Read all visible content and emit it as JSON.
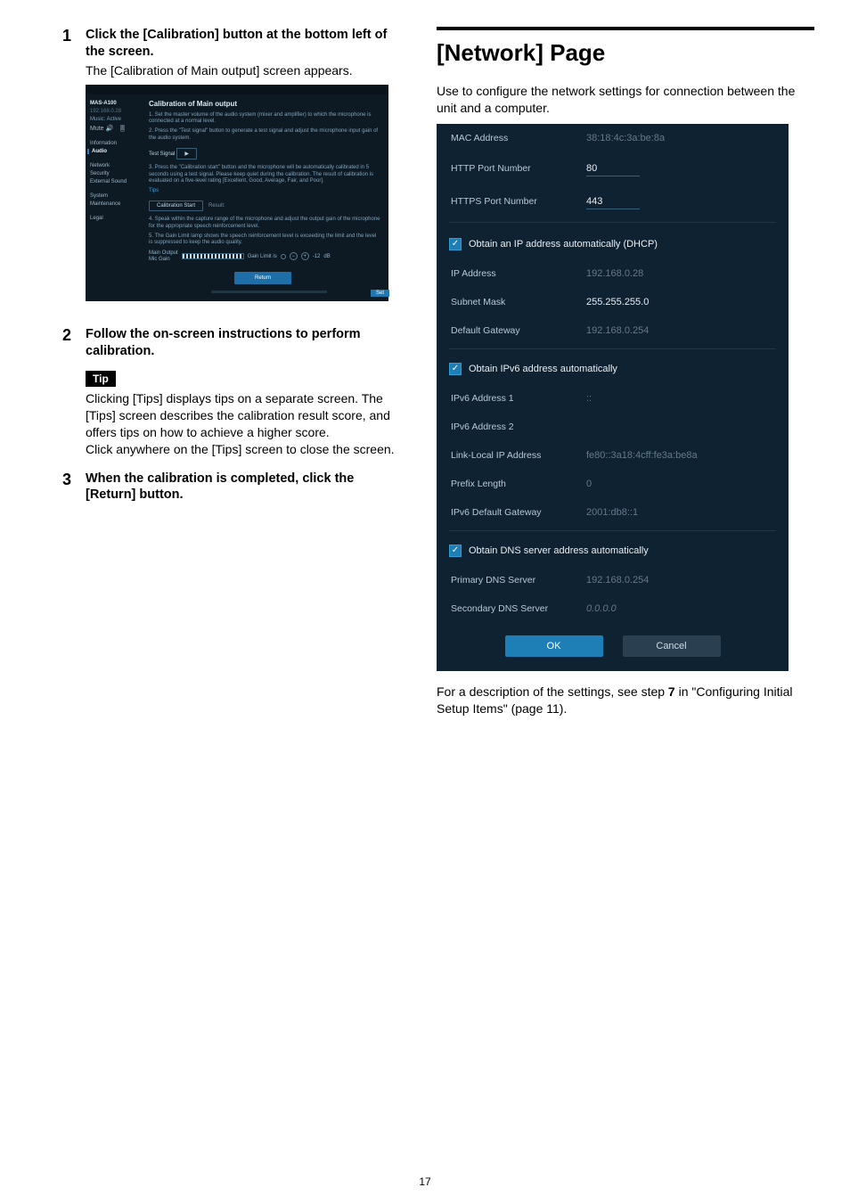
{
  "page_number": "17",
  "left": {
    "steps": [
      {
        "num": "1",
        "title": "Click the [Calibration] button at the bottom left of the screen.",
        "sub": "The [Calibration of Main output] screen appears."
      },
      {
        "num": "2",
        "title": "Follow the on-screen instructions to perform calibration."
      },
      {
        "num": "3",
        "title": "When the calibration is completed, click the [Return] button."
      }
    ],
    "tip_label": "Tip",
    "tip_body_1": "Clicking [Tips] displays tips on a separate screen. The [Tips] screen describes the calibration result score, and offers tips on how to achieve a higher score.",
    "tip_body_2": "Click anywhere on the [Tips] screen to close the screen."
  },
  "app": {
    "device": "MAS-A100",
    "ip_small": "192.168.0.28",
    "music_label": "Music: Active",
    "mute_label": "Mute",
    "sidebar": {
      "information": "Information",
      "audio": "Audio",
      "network": "Network",
      "security": "Security",
      "external_sound": "External Sound",
      "system": "System",
      "maintenance": "Maintenance",
      "legal": "Legal"
    },
    "heading": "Calibration of Main output",
    "p1": "1. Set the master volume of the audio system (mixer and amplifier) to which the microphone is connected at a normal level.",
    "p2": "2. Press the \"Test signal\" button to generate a test signal and adjust the microphone input gain of the audio system.",
    "test_signal_label": "Test Signal",
    "p3": "3. Press the \"Calibration start\" button and the microphone will be automatically calibrated in 5 seconds using a test signal. Please keep quiet during the calibration. The result of calibration is evaluated on a five-level rating [Excellent, Good, Average, Fair, and Poor].",
    "tips_link": "Tips",
    "calib_start": "Calibration Start",
    "result_label": "Result:",
    "p4": "4. Speak within the capture range of the microphone and adjust the output gain of the microphone for the appropriate speech reinforcement level.",
    "p5": "5. The Gain Limit lamp shows the speech reinforcement level is exceeding the limit and the level is suppressed to keep the audio quality.",
    "meter_l1": "Main Output",
    "meter_l2": "Mic Gain",
    "gain_limit": "Gain Limit is",
    "minus": "−",
    "plus": "+",
    "gain_val": "-12",
    "gain_unit": "dB",
    "return_btn": "Return",
    "set_chip": "Set"
  },
  "right": {
    "title": "[Network] Page",
    "lead": "Use to configure the network settings for connection between the unit and a computer.",
    "after_1": "For a description of the settings, see step ",
    "after_bold": "7",
    "after_2": " in \"Configuring Initial Setup Items\" (page 11)."
  },
  "net": {
    "rows": {
      "mac_label": "MAC Address",
      "mac_val": "38:18:4c:3a:be:8a",
      "http_label": "HTTP Port Number",
      "http_val": "80",
      "https_label": "HTTPS Port Number",
      "https_val": "443"
    },
    "dhcp_head": "Obtain an IP address automatically (DHCP)",
    "ipv4": {
      "ip_label": "IP Address",
      "ip_val": "192.168.0.28",
      "mask_label": "Subnet Mask",
      "mask_val": "255.255.255.0",
      "gw_label": "Default Gateway",
      "gw_val": "192.168.0.254"
    },
    "ipv6_head": "Obtain IPv6 address automatically",
    "ipv6": {
      "a1_label": "IPv6 Address 1",
      "a1_val": "::",
      "a2_label": "IPv6 Address 2",
      "a2_val": "",
      "ll_label": "Link-Local IP Address",
      "ll_val": "fe80::3a18:4cff:fe3a:be8a",
      "plen_label": "Prefix Length",
      "plen_val": "0",
      "gw_label": "IPv6 Default Gateway",
      "gw_val": "2001:db8::1"
    },
    "dns_head": "Obtain DNS server address automatically",
    "dns": {
      "p_label": "Primary DNS Server",
      "p_val": "192.168.0.254",
      "s_label": "Secondary DNS Server",
      "s_val": "0.0.0.0"
    },
    "ok": "OK",
    "cancel": "Cancel"
  }
}
